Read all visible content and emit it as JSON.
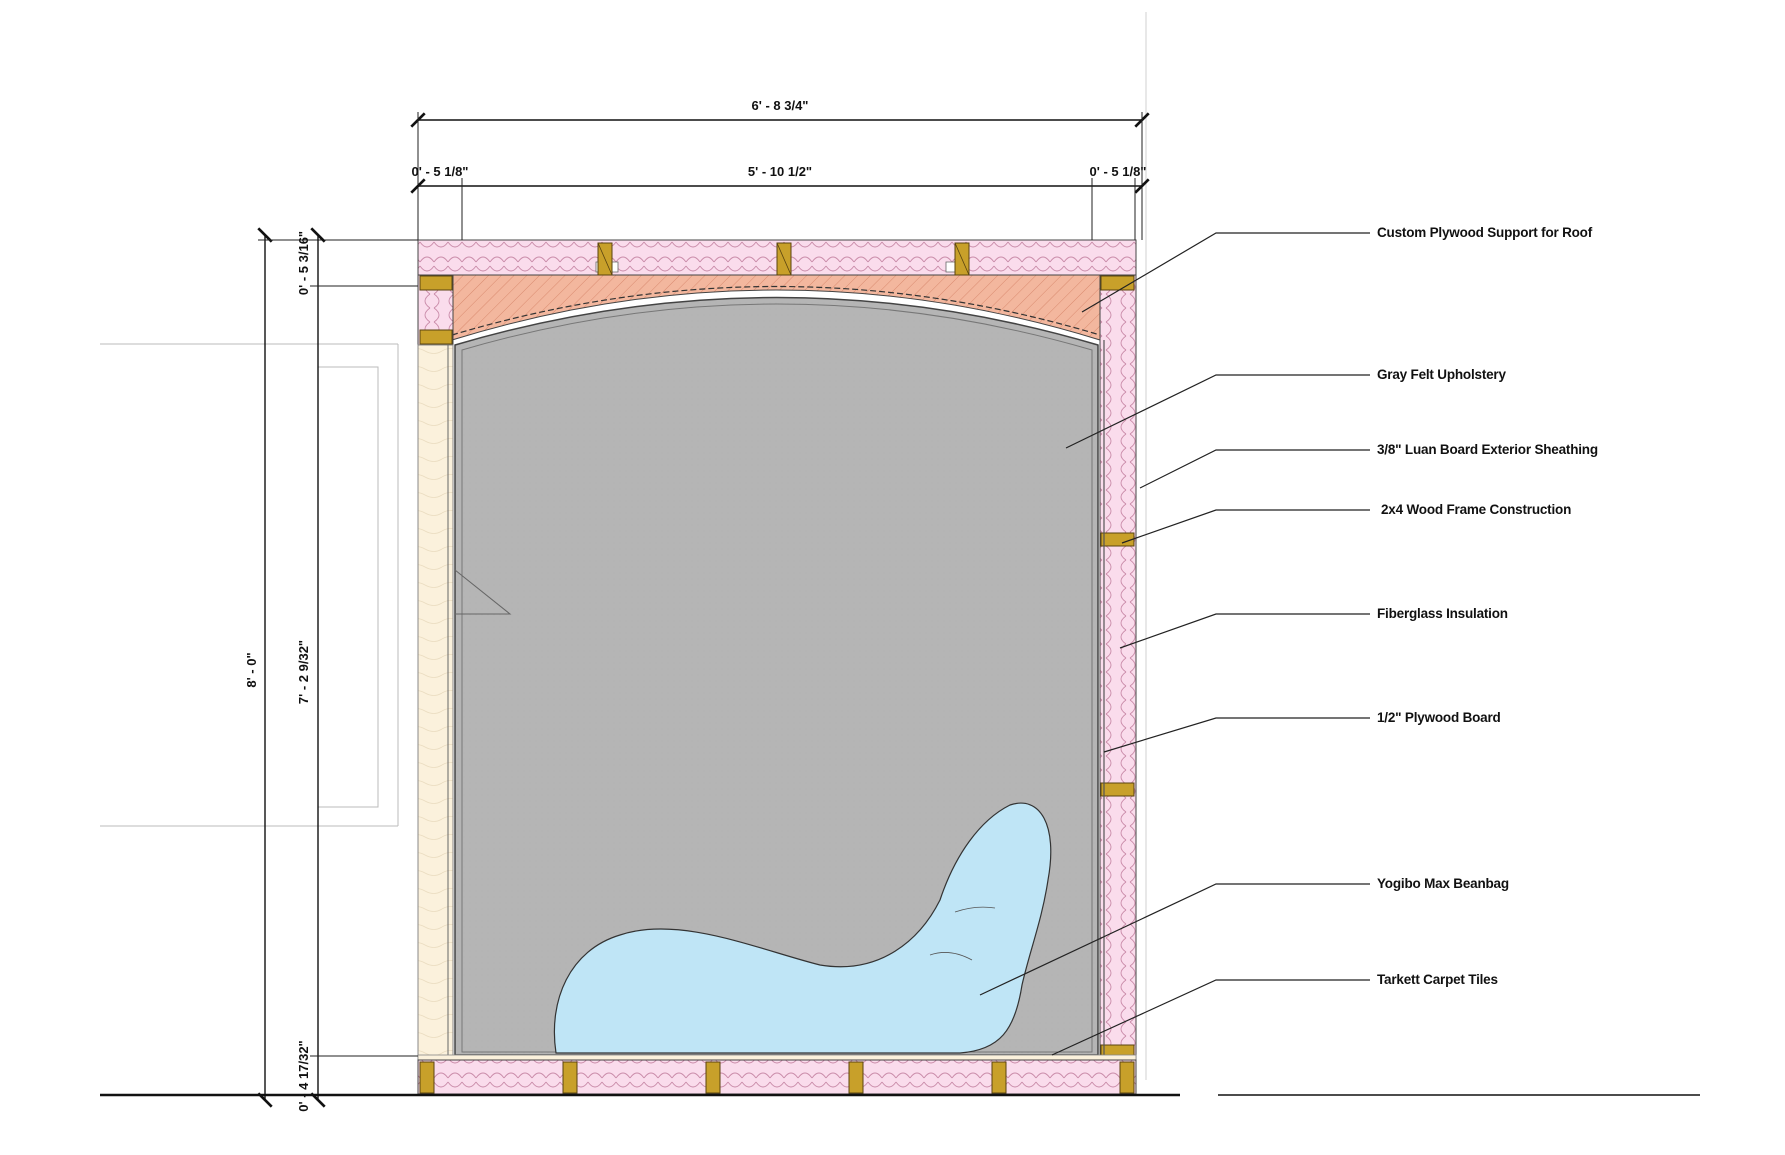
{
  "dimensions": {
    "overall_width": "6' - 8 3/4\"",
    "left_wall": "0' - 5 1/8\"",
    "interior_width": "5' - 10 1/2\"",
    "right_wall": "0' - 5 1/8\"",
    "overall_height": "8' - 0\"",
    "roof_thickness": "0' - 5 3/16\"",
    "interior_height": "7' - 2 9/32\"",
    "floor_thickness": "0' - 4 17/32\""
  },
  "labels": [
    {
      "id": "roof-support",
      "text": "Custom Plywood Support for Roof"
    },
    {
      "id": "upholstery",
      "text": "Gray Felt Upholstery"
    },
    {
      "id": "sheathing",
      "text": "3/8\" Luan Board Exterior Sheathing"
    },
    {
      "id": "framing",
      "text": "2x4 Wood Frame Construction"
    },
    {
      "id": "insulation",
      "text": "Fiberglass Insulation"
    },
    {
      "id": "plywood",
      "text": "1/2\" Plywood Board"
    },
    {
      "id": "beanbag",
      "text": "Yogibo Max Beanbag"
    },
    {
      "id": "carpet",
      "text": "Tarkett Carpet Tiles"
    }
  ],
  "colors": {
    "insulation": "#fadcec",
    "stud": "#c8a02a",
    "roof_support": "#f3b79e",
    "upholstery": "#b5b5b5",
    "beanbag": "#bfe5f6",
    "sheathing": "#fbf1dc"
  }
}
